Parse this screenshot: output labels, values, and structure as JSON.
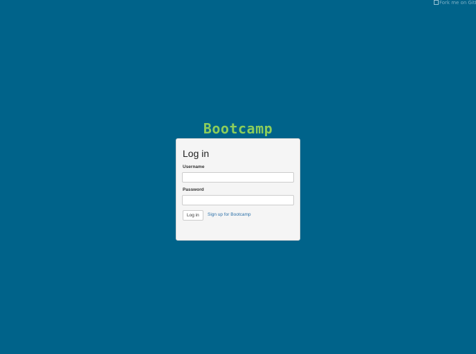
{
  "colors": {
    "background": "#00638a",
    "logo": "#8ccd5b",
    "card": "#f5f5f5",
    "link": "#2a6fa8"
  },
  "fork_ribbon": {
    "alt_text": "Fork me on GitHub",
    "icon": "broken-image-icon"
  },
  "logo": {
    "text": "Bootcamp"
  },
  "login_form": {
    "title": "Log in",
    "username": {
      "label": "Username",
      "value": "",
      "placeholder": ""
    },
    "password": {
      "label": "Password",
      "value": "",
      "placeholder": ""
    },
    "submit_label": "Log in",
    "signup_link_text": "Sign up for Bootcamp"
  }
}
